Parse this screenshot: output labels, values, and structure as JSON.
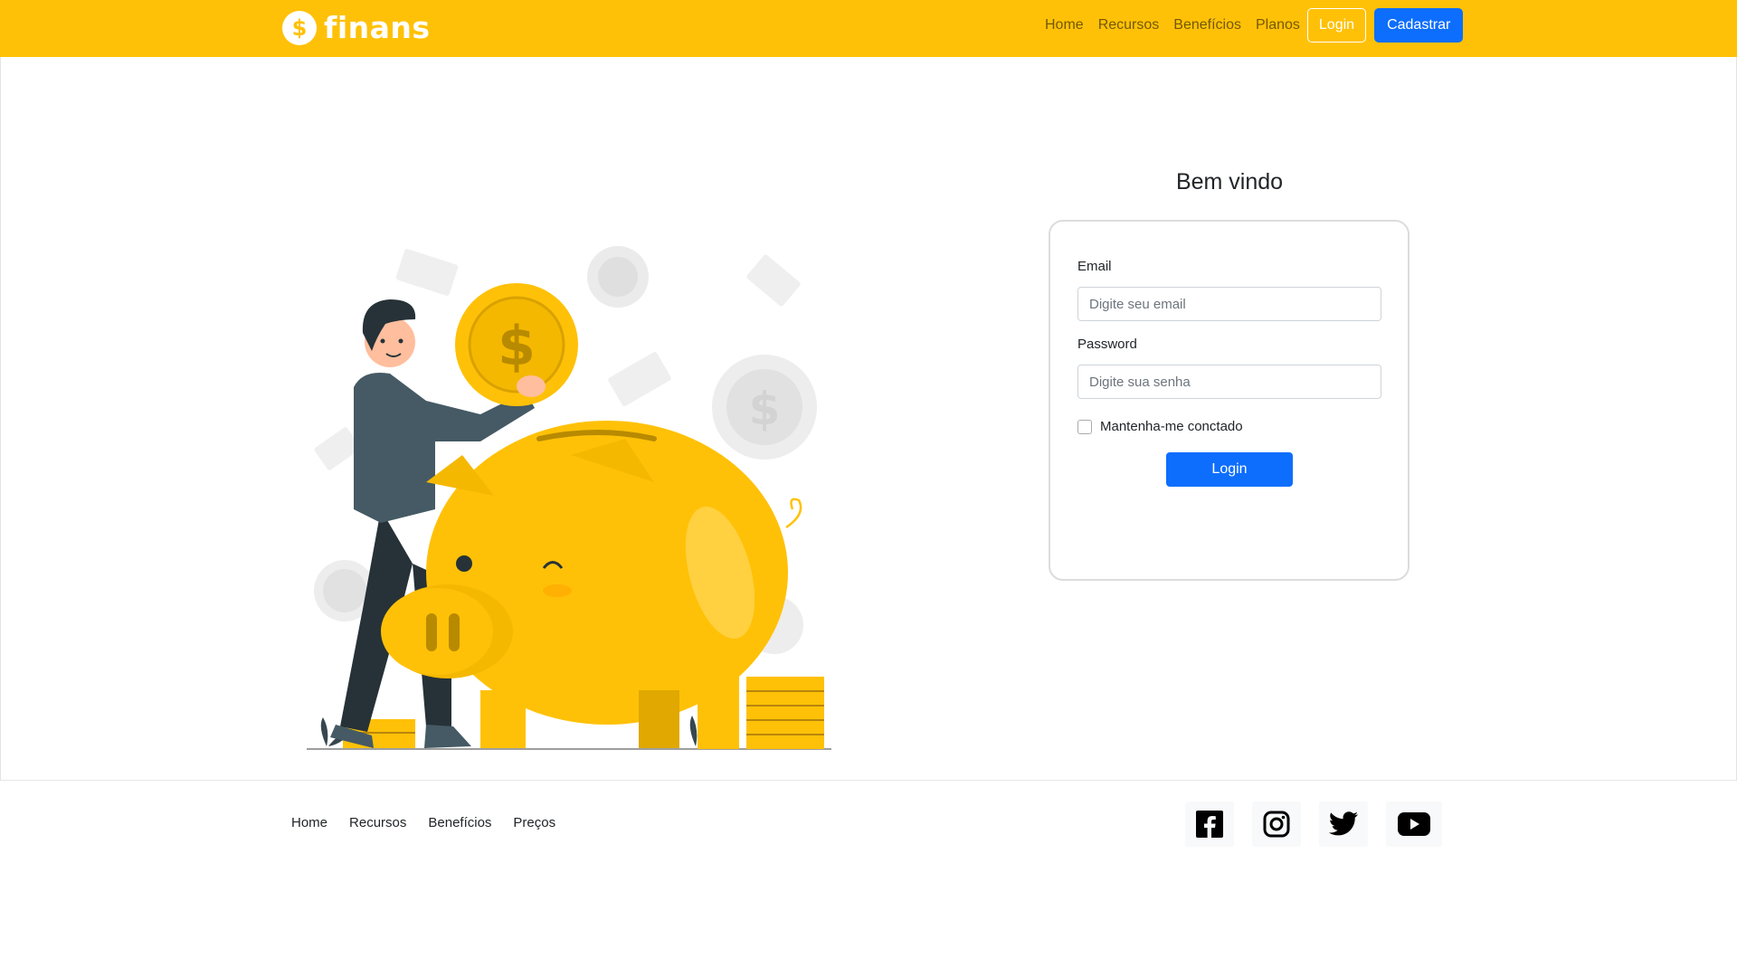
{
  "header": {
    "brand": "finans",
    "brand_color": "#ffc107",
    "nav": {
      "home": "Home",
      "recursos": "Recursos",
      "beneficios": "Benefícios",
      "planos": "Planos"
    },
    "login_button": "Login",
    "signup_button": "Cadastrar"
  },
  "login": {
    "title": "Bem vindo",
    "email_label": "Email",
    "email_placeholder": "Digite seu email",
    "password_label": "Password",
    "password_placeholder": "Digite sua senha",
    "remember_label": "Mantenha-me conctado",
    "remember_checked": false,
    "submit": "Login",
    "accent_color": "#0d6efd"
  },
  "footer": {
    "links": {
      "home": "Home",
      "recursos": "Recursos",
      "beneficios": "Benefícios",
      "precos": "Preços"
    },
    "socials": [
      "facebook-icon",
      "instagram-icon",
      "twitter-icon",
      "youtube-icon"
    ]
  }
}
